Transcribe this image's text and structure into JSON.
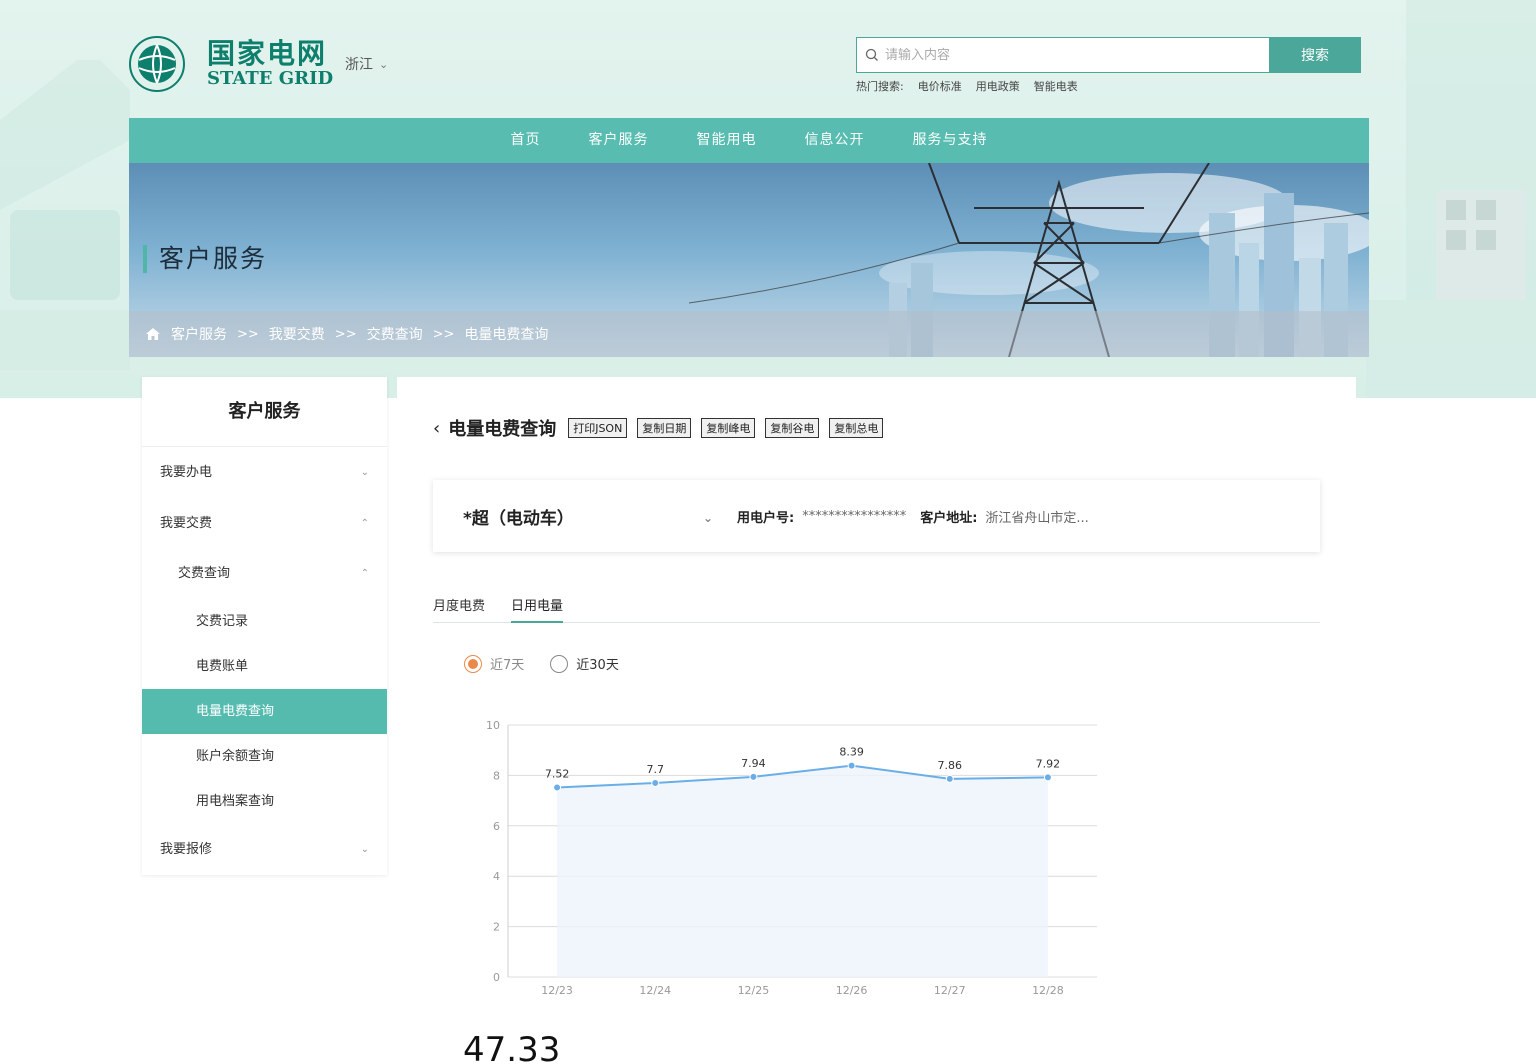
{
  "header": {
    "logo_cn": "国家电网",
    "logo_en": "STATE GRID",
    "region": "浙江",
    "search_placeholder": "请输入内容",
    "search_button": "搜索",
    "hot_label": "热门搜索:",
    "hot_items": [
      "电价标准",
      "用电政策",
      "智能电表"
    ]
  },
  "nav": [
    "首页",
    "客户服务",
    "智能用电",
    "信息公开",
    "服务与支持"
  ],
  "banner": {
    "title": "客户服务",
    "breadcrumbs": [
      "客户服务",
      "我要交费",
      "交费查询",
      "电量电费查询"
    ],
    "separator": ">>"
  },
  "sidebar": {
    "title": "客户服务",
    "items": [
      {
        "label": "我要办电"
      },
      {
        "label": "我要交费"
      },
      {
        "label": "交费查询"
      },
      {
        "label": "交费记录"
      },
      {
        "label": "电费账单"
      },
      {
        "label": "电量电费查询"
      },
      {
        "label": "账户余额查询"
      },
      {
        "label": "用电档案查询"
      },
      {
        "label": "我要报修"
      }
    ]
  },
  "main": {
    "title": "电量电费查询",
    "tools": [
      "打印JSON",
      "复制日期",
      "复制峰电",
      "复制谷电",
      "复制总电"
    ],
    "account": {
      "name": "*超（电动车）",
      "user_no_label": "用电户号:",
      "user_no": "****************",
      "address_label": "客户地址:",
      "address": "浙江省舟山市定..."
    },
    "tabs": [
      "月度电费",
      "日用电量"
    ],
    "ranges": [
      "近7天",
      "近30天"
    ],
    "total": "47.33"
  },
  "colors": {
    "accent": "#55bbaf",
    "nav": "#58bcb0",
    "line": "#6aaee8",
    "radio": "#e98a4b"
  },
  "chart_data": {
    "type": "area",
    "categories": [
      "12/23",
      "12/24",
      "12/25",
      "12/26",
      "12/27",
      "12/28"
    ],
    "values": [
      7.52,
      7.7,
      7.94,
      8.39,
      7.86,
      7.92
    ],
    "ylim": [
      0,
      10
    ],
    "yticks": [
      0,
      2,
      4,
      6,
      8,
      10
    ],
    "grid": true
  }
}
